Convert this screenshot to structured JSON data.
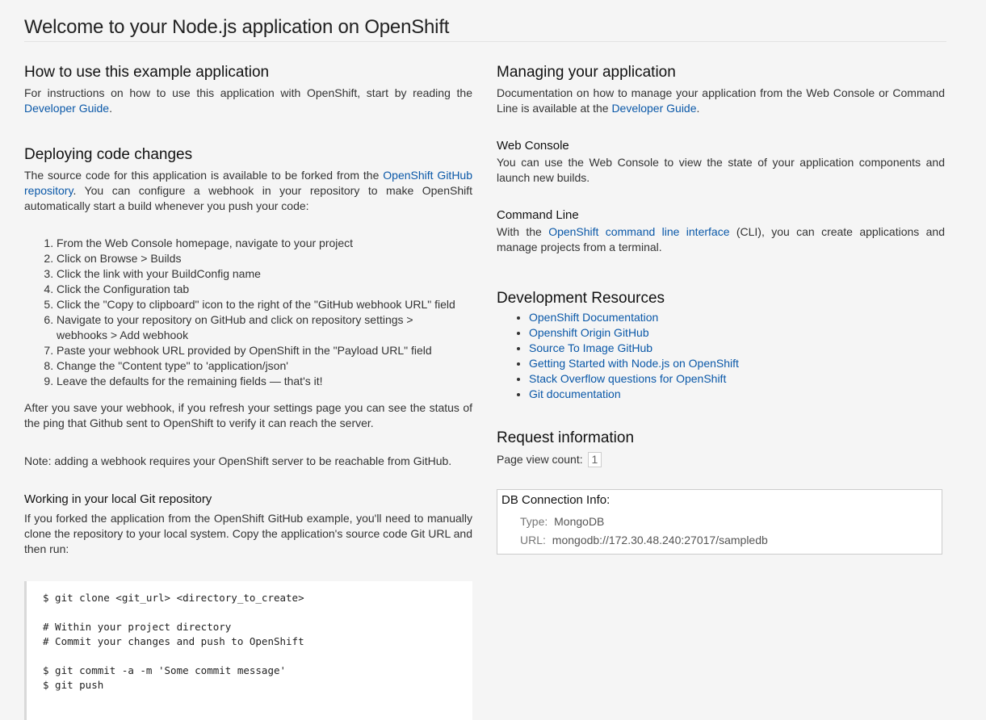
{
  "page_title": "Welcome to your Node.js application on OpenShift",
  "left": {
    "how_to": {
      "heading": "How to use this example application",
      "text_before": "For instructions on how to use this application with OpenShift, start by reading the ",
      "link": "Developer Guide",
      "text_after": "."
    },
    "deploying": {
      "heading": "Deploying code changes",
      "text_before": "The source code for this application is available to be forked from the ",
      "link": "OpenShift GitHub repository",
      "text_after": ". You can configure a webhook in your repository to make OpenShift automatically start a build whenever you push your code:",
      "steps": [
        "From the Web Console homepage, navigate to your project",
        "Click on Browse > Builds",
        "Click the link with your BuildConfig name",
        "Click the Configuration tab",
        "Click the \"Copy to clipboard\" icon to the right of the \"GitHub webhook URL\" field",
        "Navigate to your repository on GitHub and click on repository settings > webhooks > Add webhook",
        "Paste your webhook URL provided by OpenShift in the \"Payload URL\" field",
        "Change the \"Content type\" to 'application/json'",
        "Leave the defaults for the remaining fields — that's it!"
      ],
      "after_save": "After you save your webhook, if you refresh your settings page you can see the status of the ping that Github sent to OpenShift to verify it can reach the server.",
      "note": "Note: adding a webhook requires your OpenShift server to be reachable from GitHub."
    },
    "local_git": {
      "heading": "Working in your local Git repository",
      "text": "If you forked the application from the OpenShift GitHub example, you'll need to manually clone the repository to your local system. Copy the application's source code Git URL and then run:",
      "code": "$ git clone <git_url> <directory_to_create>\n\n# Within your project directory\n# Commit your changes and push to OpenShift\n\n$ git commit -a -m 'Some commit message'\n$ git push"
    }
  },
  "right": {
    "managing": {
      "heading": "Managing your application",
      "text_before": "Documentation on how to manage your application from the Web Console or Command Line is available at the ",
      "link": "Developer Guide",
      "text_after": "."
    },
    "web_console": {
      "heading": "Web Console",
      "text": "You can use the Web Console to view the state of your application components and launch new builds."
    },
    "command_line": {
      "heading": "Command Line",
      "text_before": "With the ",
      "link": "OpenShift command line interface",
      "text_after": " (CLI), you can create applications and manage projects from a terminal."
    },
    "resources": {
      "heading": "Development Resources",
      "links": [
        "OpenShift Documentation",
        "Openshift Origin GitHub",
        "Source To Image GitHub",
        "Getting Started with Node.js on OpenShift",
        "Stack Overflow questions for OpenShift",
        "Git documentation"
      ]
    },
    "request": {
      "heading": "Request information",
      "count_label": "Page view count:",
      "count_value": "1"
    },
    "db": {
      "title": "DB Connection Info:",
      "type_label": "Type:",
      "type_value": "MongoDB",
      "url_label": "URL:",
      "url_value": "mongodb://172.30.48.240:27017/sampledb"
    }
  },
  "colors": {
    "link": "#0a58a8",
    "background": "#f5f5f5",
    "text": "#333333"
  }
}
